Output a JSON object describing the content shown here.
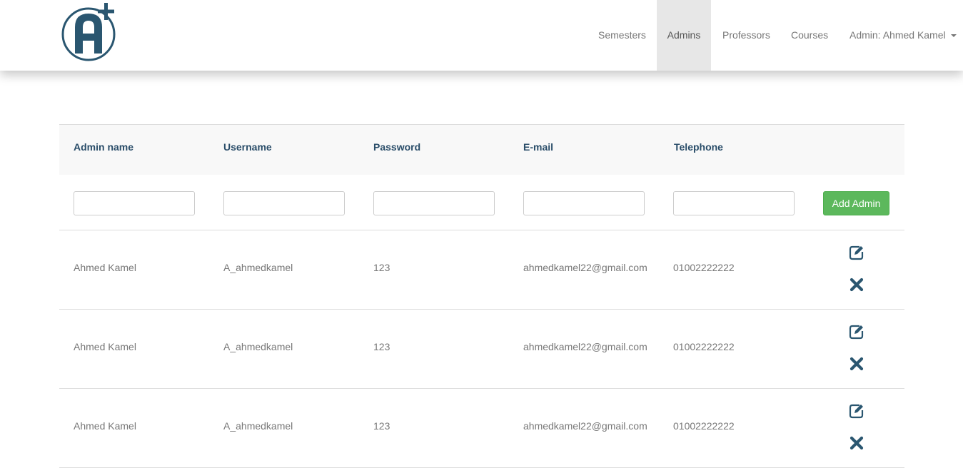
{
  "brand": {
    "logo_icon": "a-plus-logo-icon",
    "color": "#2a5670"
  },
  "nav": {
    "items": [
      {
        "label": "Semesters",
        "active": false
      },
      {
        "label": "Admins",
        "active": true
      },
      {
        "label": "Professors",
        "active": false
      },
      {
        "label": "Courses",
        "active": false
      }
    ],
    "user_menu": "Admin: Ahmed Kamel"
  },
  "table": {
    "headers": [
      "Admin name",
      "Username",
      "Password",
      "E-mail",
      "Telephone"
    ],
    "add_button": "Add Admin",
    "rows": [
      {
        "name": "Ahmed Kamel",
        "username": "A_ahmedkamel",
        "password": "123",
        "email": "ahmedkamel22@gmail.com",
        "telephone": "01002222222"
      },
      {
        "name": "Ahmed Kamel",
        "username": "A_ahmedkamel",
        "password": "123",
        "email": "ahmedkamel22@gmail.com",
        "telephone": "01002222222"
      },
      {
        "name": "Ahmed Kamel",
        "username": "A_ahmedkamel",
        "password": "123",
        "email": "ahmedkamel22@gmail.com",
        "telephone": "01002222222"
      }
    ],
    "row_actions": [
      "edit-icon",
      "delete-icon"
    ]
  },
  "colors": {
    "accent": "#2a4d69",
    "success": "#5cb85c",
    "nav_active_bg": "#e7e7e7"
  }
}
